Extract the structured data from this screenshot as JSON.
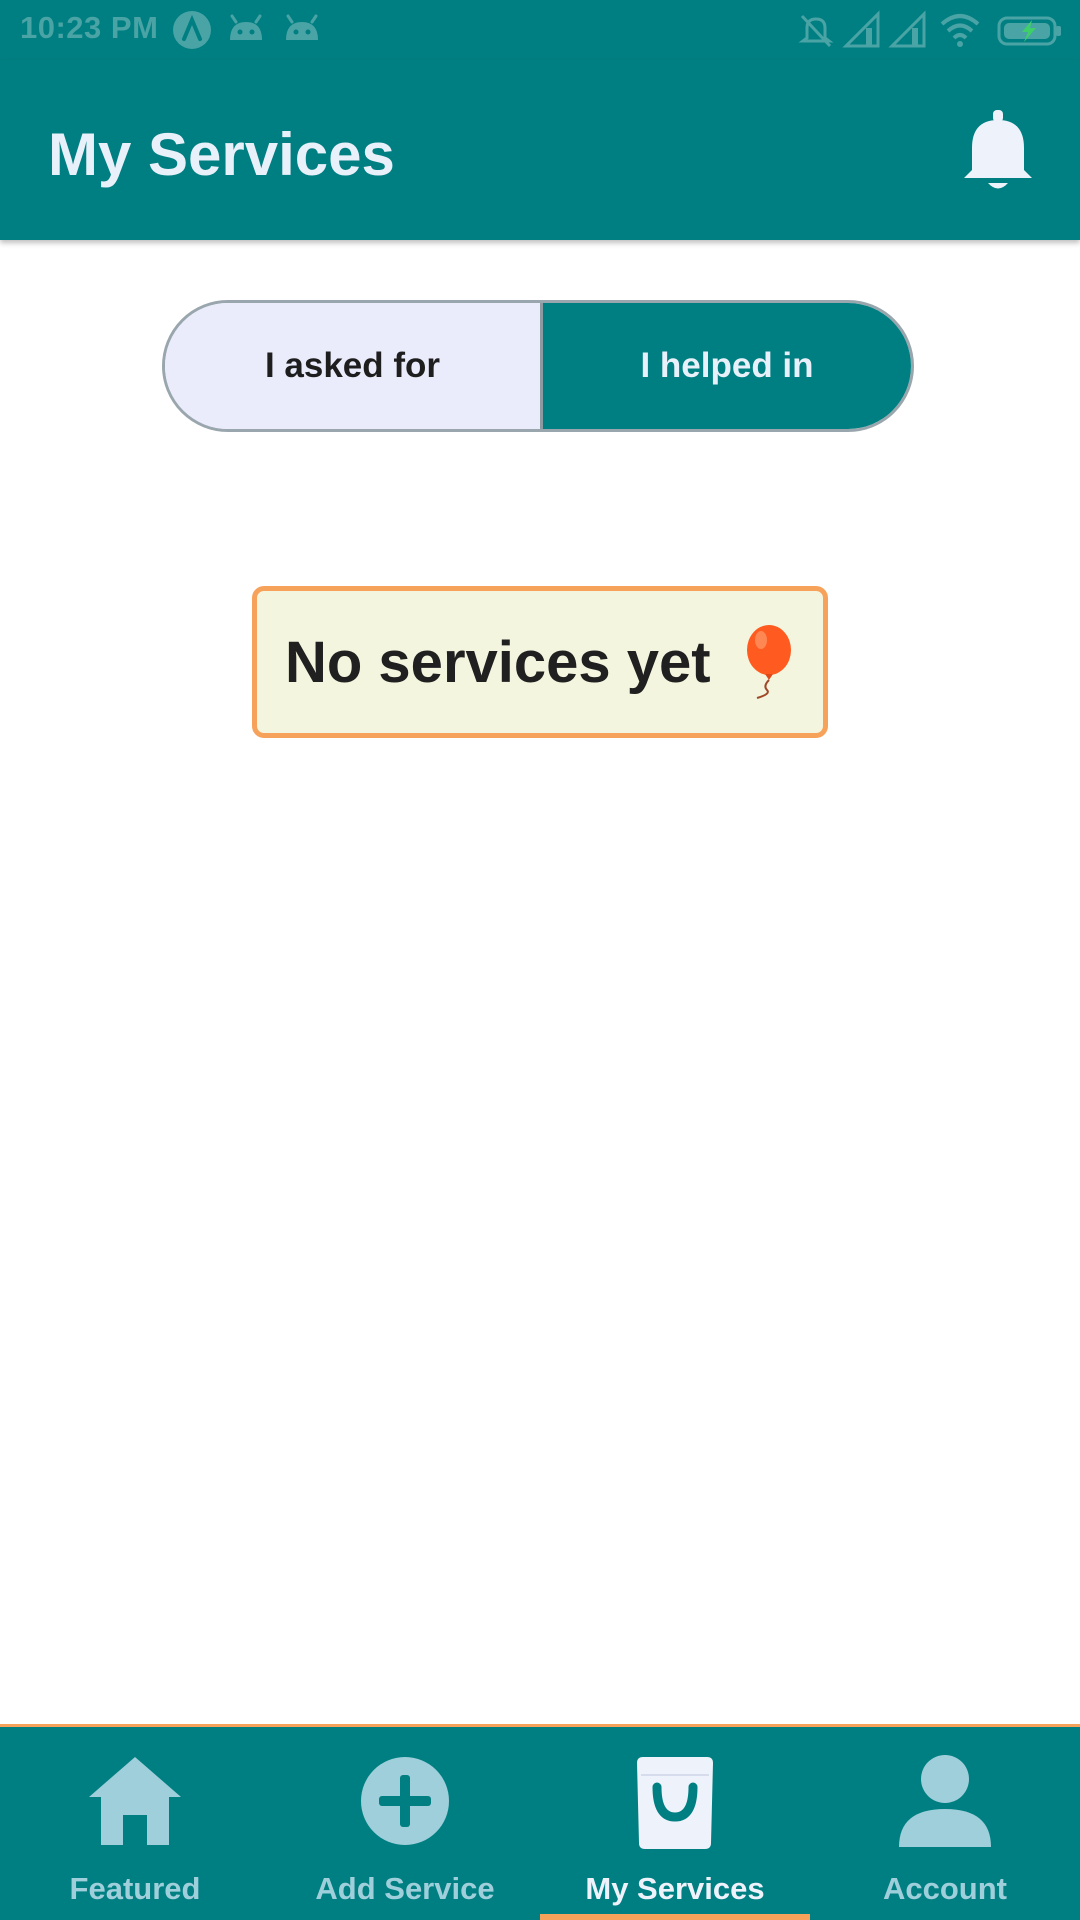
{
  "status_bar": {
    "time": "10:23 PM",
    "icons": [
      "app-a-icon",
      "android-icon",
      "android-icon",
      "mute-bell-icon",
      "signal-icon",
      "signal-icon",
      "wifi-icon",
      "battery-charging-icon"
    ]
  },
  "header": {
    "title": "My Services",
    "notification_icon": "bell-icon"
  },
  "toggle": {
    "options": [
      "I asked for",
      "I helped in"
    ],
    "selected": "I helped in"
  },
  "empty_state": {
    "message": "No services yet",
    "emoji_icon": "balloon-icon"
  },
  "bottom_nav": {
    "items": [
      {
        "label": "Featured",
        "icon": "home-icon"
      },
      {
        "label": "Add Service",
        "icon": "plus-circle-icon"
      },
      {
        "label": "My Services",
        "icon": "shopping-bag-icon"
      },
      {
        "label": "Account",
        "icon": "person-icon"
      }
    ],
    "active": "My Services"
  },
  "colors": {
    "primary": "#007f82",
    "accent": "#f7a25b",
    "selected_segment": "#eaecfb",
    "card_background": "#f4f5de",
    "inactive_nav": "#9fcfda"
  }
}
